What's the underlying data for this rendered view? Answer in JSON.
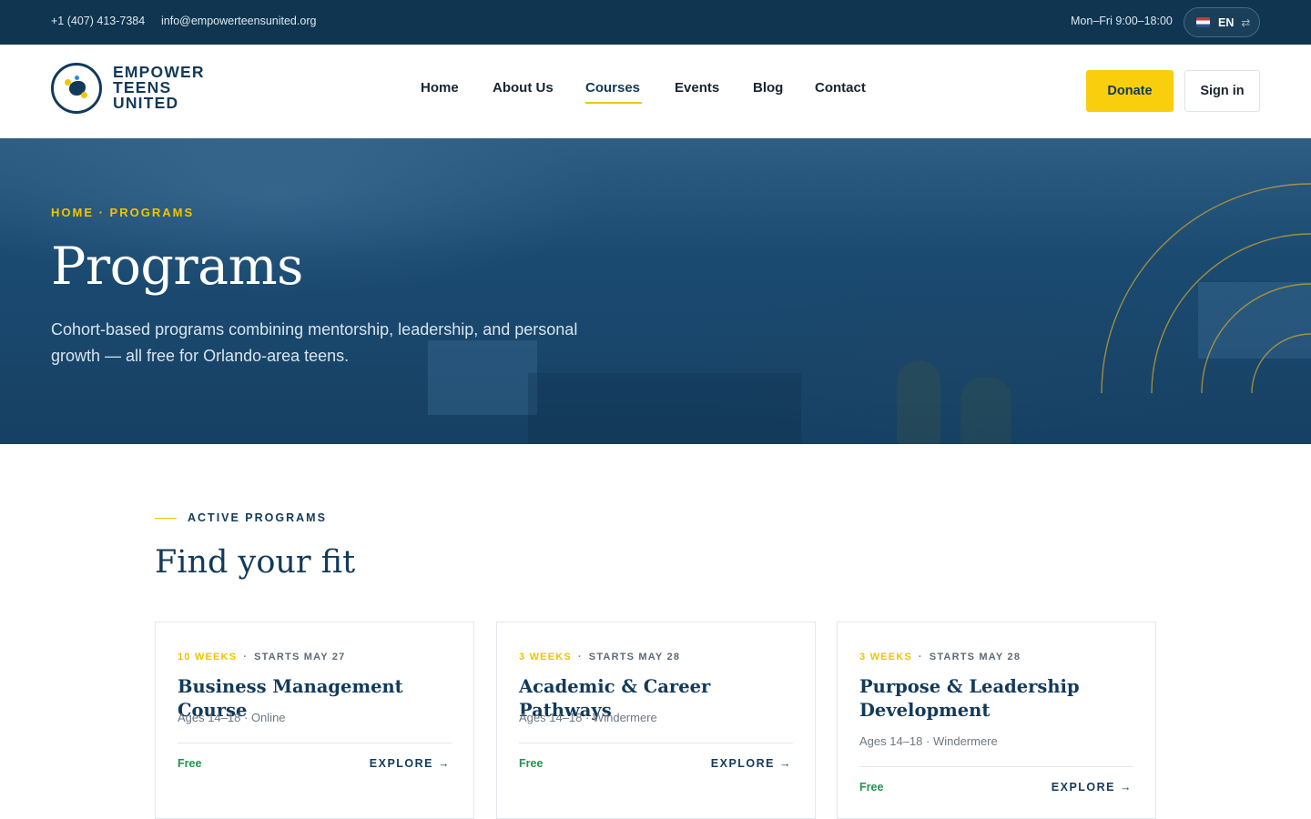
{
  "topbar": {
    "phone": "+1 (407) 413-7384",
    "email": "info@empowerteensunited.org",
    "hours": "Mon–Fri 9:00–18:00",
    "language": "EN",
    "language_swap_icon": "⇄"
  },
  "brand": {
    "line1": "EMPOWER",
    "line2": "TEENS",
    "line3": "UNITED",
    "primary_color": "#123a5a",
    "accent_color": "#f9cf0d"
  },
  "nav": {
    "items": [
      {
        "label": "Home"
      },
      {
        "label": "About Us"
      },
      {
        "label": "Courses",
        "active": true
      },
      {
        "label": "Events"
      },
      {
        "label": "Blog"
      },
      {
        "label": "Contact"
      }
    ],
    "donate_label": "Donate",
    "signin_label": "Sign in"
  },
  "hero": {
    "breadcrumb": "HOME · PROGRAMS",
    "title": "Programs",
    "description": "Cohort-based programs combining mentorship, leadership, and personal growth — all free for Orlando-area teens."
  },
  "section": {
    "eyebrow": "ACTIVE PROGRAMS",
    "title": "Find your fit"
  },
  "programs": [
    {
      "duration": "10 WEEKS",
      "separator": "·",
      "starts": "STARTS MAY 27",
      "title": "Business Management Course",
      "info": "Ages 14–18 · Online",
      "price": "Free",
      "cta": "EXPLORE →"
    },
    {
      "duration": "3 WEEKS",
      "separator": "·",
      "starts": "STARTS MAY 28",
      "title": "Academic & Career Pathways",
      "info": "Ages 14–18 · Windermere",
      "price": "Free",
      "cta": "EXPLORE →"
    },
    {
      "duration": "3 WEEKS",
      "separator": "·",
      "starts": "STARTS MAY 28",
      "title": "Purpose & Leadership Development",
      "info": "Ages 14–18 · Windermere",
      "price": "Free",
      "cta": "EXPLORE →"
    }
  ]
}
